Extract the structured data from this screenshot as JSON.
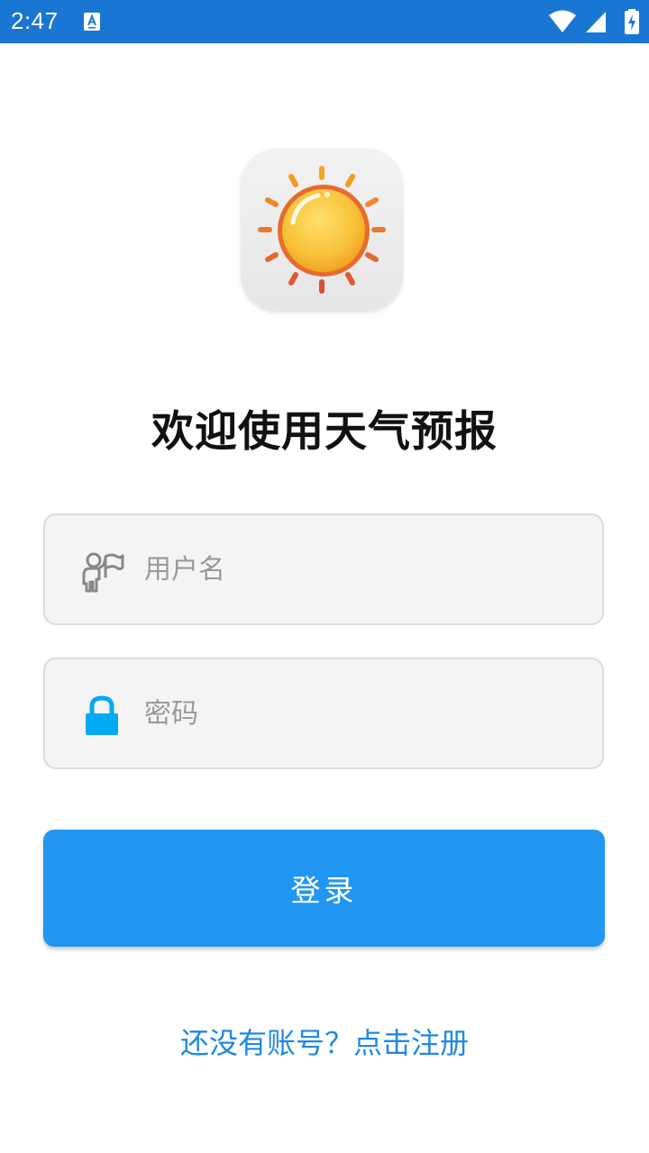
{
  "status_bar": {
    "time": "2:47",
    "icons": [
      "text-a-icon",
      "wifi-icon",
      "cellular-signal-icon",
      "battery-charging-icon"
    ],
    "background_color": "#1976D2"
  },
  "app": {
    "logo_icon": "sun-icon"
  },
  "welcome": {
    "title": "欢迎使用天气预报"
  },
  "form": {
    "username": {
      "icon": "user-icon",
      "placeholder": "用户名",
      "value": ""
    },
    "password": {
      "icon": "lock-icon",
      "placeholder": "密码",
      "value": ""
    }
  },
  "login_button": {
    "label": "登录",
    "color": "#2196F3"
  },
  "register_link": {
    "text": "还没有账号？点击注册",
    "color": "#1E88E5"
  }
}
